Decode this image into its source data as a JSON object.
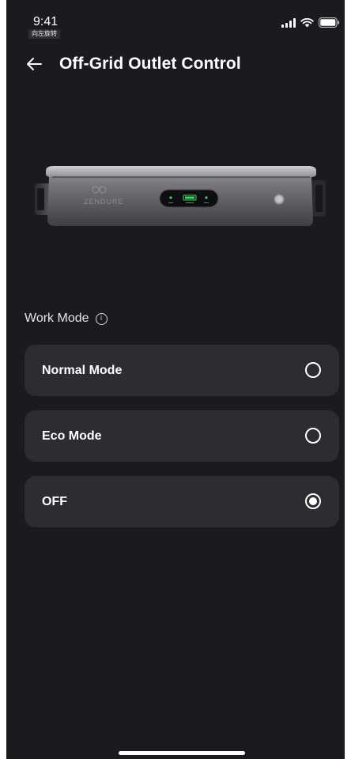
{
  "status_bar": {
    "time": "9:41",
    "rotate_badge": "向左旋转"
  },
  "header": {
    "title": "Off-Grid Outlet Control"
  },
  "device": {
    "brand_text": "ZENDURE"
  },
  "work_mode": {
    "label": "Work Mode",
    "info_glyph": "i",
    "options": [
      {
        "label": "Normal Mode",
        "selected": false
      },
      {
        "label": "Eco Mode",
        "selected": false
      },
      {
        "label": "OFF",
        "selected": true
      }
    ]
  },
  "colors": {
    "background": "#1b1b1f",
    "card": "#2d2d31",
    "led_green": "#3ddc5a"
  }
}
